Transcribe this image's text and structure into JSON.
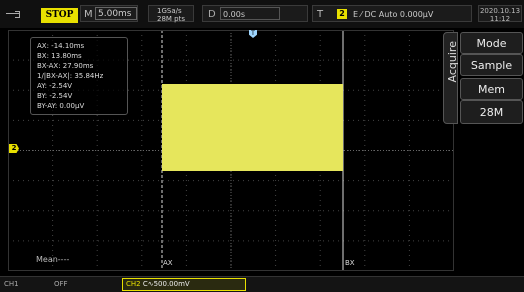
{
  "topbar": {
    "run_state": "STOP",
    "timebase_prefix": "M",
    "timebase_value": "5.00ms",
    "sample_rate": "1GSa/s",
    "memory_points": "28M pts",
    "delay_prefix": "D",
    "delay_value": "0.00s",
    "trigger_prefix": "T",
    "trigger_channel": "2",
    "trigger_text": "E ⁄ DC Auto 0.000μV",
    "date": "2020.10.13",
    "time": "11:12"
  },
  "measurements": {
    "ax": "AX: -14.10ms",
    "bx": "BX: 13.80ms",
    "bx_ax": "BX-AX: 27.90ms",
    "inv": "1/|BX-AX|: 35.84Hz",
    "ay": "AY: -2.54V",
    "by": "BY: -2.54V",
    "by_ay": "BY-AY: 0.00μV"
  },
  "waveform": {
    "channel_marker": "2",
    "trigger_marker": "T",
    "color": "#e6e65c"
  },
  "cursor_labels": {
    "a": "AX",
    "b": "BX"
  },
  "mean_label": "Mean----",
  "side_menu": {
    "title": "Acquire",
    "mode_label": "Mode",
    "mode_value": "Sample",
    "mem_label": "Mem Depth",
    "mem_value": "28M"
  },
  "bottombar": {
    "ch1_label": "CH1",
    "ch1_state": "OFF",
    "ch2_label": "CH2",
    "ch2_value": "C∿500.00mV"
  },
  "colors": {
    "accent": "#e8e000",
    "background": "#000000",
    "grid": "#444444"
  }
}
